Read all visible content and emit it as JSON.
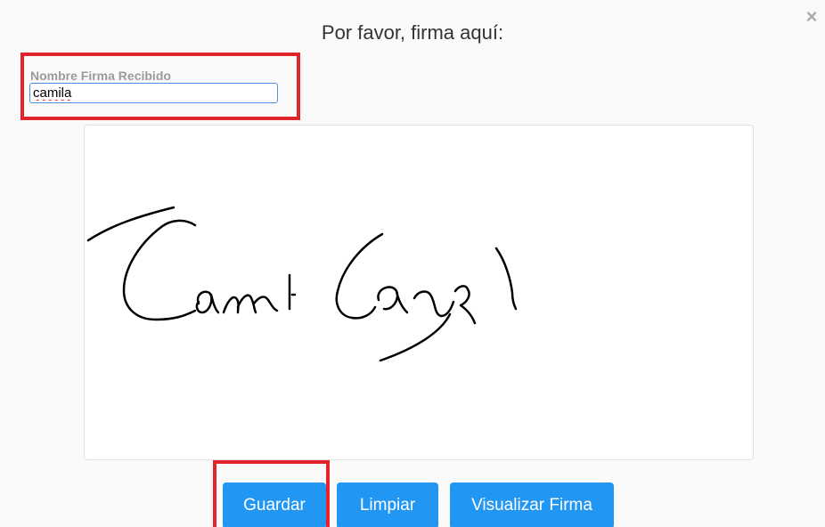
{
  "dialog": {
    "title": "Por favor, firma aquí:",
    "close_icon": "close-icon",
    "close_symbol": "×"
  },
  "form": {
    "name_label": "Nombre Firma Recibido",
    "name_value": "camila"
  },
  "signature_pad": {
    "stroke_color": "#000000",
    "background": "#ffffff"
  },
  "actions": {
    "save_label": "Guardar",
    "clear_label": "Limpiar",
    "view_label": "Visualizar Firma"
  },
  "colors": {
    "button": "#2196f3",
    "highlight": "#e3242b",
    "input_border": "#4a90e2"
  }
}
